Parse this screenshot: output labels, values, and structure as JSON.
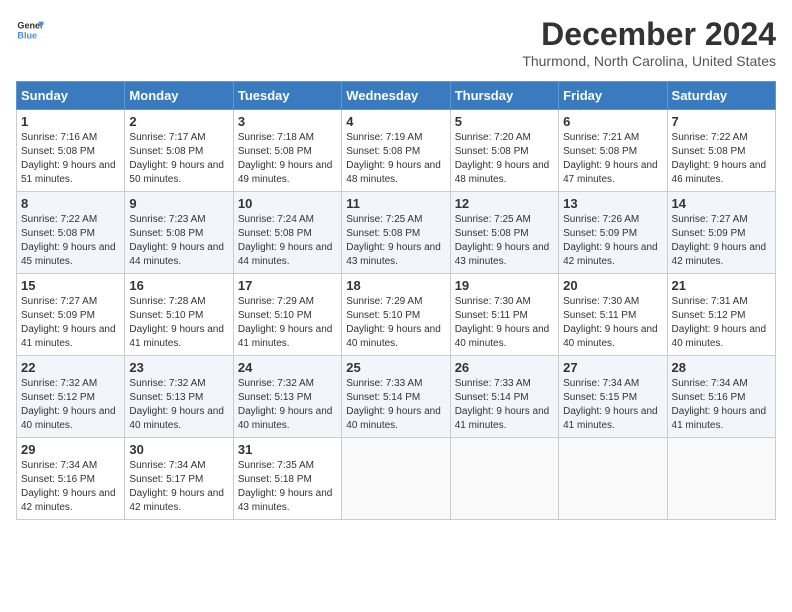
{
  "header": {
    "logo_line1": "General",
    "logo_line2": "Blue",
    "month": "December 2024",
    "location": "Thurmond, North Carolina, United States"
  },
  "days_of_week": [
    "Sunday",
    "Monday",
    "Tuesday",
    "Wednesday",
    "Thursday",
    "Friday",
    "Saturday"
  ],
  "weeks": [
    [
      {
        "day": "1",
        "sunrise": "7:16 AM",
        "sunset": "5:08 PM",
        "daylight": "9 hours and 51 minutes."
      },
      {
        "day": "2",
        "sunrise": "7:17 AM",
        "sunset": "5:08 PM",
        "daylight": "9 hours and 50 minutes."
      },
      {
        "day": "3",
        "sunrise": "7:18 AM",
        "sunset": "5:08 PM",
        "daylight": "9 hours and 49 minutes."
      },
      {
        "day": "4",
        "sunrise": "7:19 AM",
        "sunset": "5:08 PM",
        "daylight": "9 hours and 48 minutes."
      },
      {
        "day": "5",
        "sunrise": "7:20 AM",
        "sunset": "5:08 PM",
        "daylight": "9 hours and 48 minutes."
      },
      {
        "day": "6",
        "sunrise": "7:21 AM",
        "sunset": "5:08 PM",
        "daylight": "9 hours and 47 minutes."
      },
      {
        "day": "7",
        "sunrise": "7:22 AM",
        "sunset": "5:08 PM",
        "daylight": "9 hours and 46 minutes."
      }
    ],
    [
      {
        "day": "8",
        "sunrise": "7:22 AM",
        "sunset": "5:08 PM",
        "daylight": "9 hours and 45 minutes."
      },
      {
        "day": "9",
        "sunrise": "7:23 AM",
        "sunset": "5:08 PM",
        "daylight": "9 hours and 44 minutes."
      },
      {
        "day": "10",
        "sunrise": "7:24 AM",
        "sunset": "5:08 PM",
        "daylight": "9 hours and 44 minutes."
      },
      {
        "day": "11",
        "sunrise": "7:25 AM",
        "sunset": "5:08 PM",
        "daylight": "9 hours and 43 minutes."
      },
      {
        "day": "12",
        "sunrise": "7:25 AM",
        "sunset": "5:08 PM",
        "daylight": "9 hours and 43 minutes."
      },
      {
        "day": "13",
        "sunrise": "7:26 AM",
        "sunset": "5:09 PM",
        "daylight": "9 hours and 42 minutes."
      },
      {
        "day": "14",
        "sunrise": "7:27 AM",
        "sunset": "5:09 PM",
        "daylight": "9 hours and 42 minutes."
      }
    ],
    [
      {
        "day": "15",
        "sunrise": "7:27 AM",
        "sunset": "5:09 PM",
        "daylight": "9 hours and 41 minutes."
      },
      {
        "day": "16",
        "sunrise": "7:28 AM",
        "sunset": "5:10 PM",
        "daylight": "9 hours and 41 minutes."
      },
      {
        "day": "17",
        "sunrise": "7:29 AM",
        "sunset": "5:10 PM",
        "daylight": "9 hours and 41 minutes."
      },
      {
        "day": "18",
        "sunrise": "7:29 AM",
        "sunset": "5:10 PM",
        "daylight": "9 hours and 40 minutes."
      },
      {
        "day": "19",
        "sunrise": "7:30 AM",
        "sunset": "5:11 PM",
        "daylight": "9 hours and 40 minutes."
      },
      {
        "day": "20",
        "sunrise": "7:30 AM",
        "sunset": "5:11 PM",
        "daylight": "9 hours and 40 minutes."
      },
      {
        "day": "21",
        "sunrise": "7:31 AM",
        "sunset": "5:12 PM",
        "daylight": "9 hours and 40 minutes."
      }
    ],
    [
      {
        "day": "22",
        "sunrise": "7:32 AM",
        "sunset": "5:12 PM",
        "daylight": "9 hours and 40 minutes."
      },
      {
        "day": "23",
        "sunrise": "7:32 AM",
        "sunset": "5:13 PM",
        "daylight": "9 hours and 40 minutes."
      },
      {
        "day": "24",
        "sunrise": "7:32 AM",
        "sunset": "5:13 PM",
        "daylight": "9 hours and 40 minutes."
      },
      {
        "day": "25",
        "sunrise": "7:33 AM",
        "sunset": "5:14 PM",
        "daylight": "9 hours and 40 minutes."
      },
      {
        "day": "26",
        "sunrise": "7:33 AM",
        "sunset": "5:14 PM",
        "daylight": "9 hours and 41 minutes."
      },
      {
        "day": "27",
        "sunrise": "7:34 AM",
        "sunset": "5:15 PM",
        "daylight": "9 hours and 41 minutes."
      },
      {
        "day": "28",
        "sunrise": "7:34 AM",
        "sunset": "5:16 PM",
        "daylight": "9 hours and 41 minutes."
      }
    ],
    [
      {
        "day": "29",
        "sunrise": "7:34 AM",
        "sunset": "5:16 PM",
        "daylight": "9 hours and 42 minutes."
      },
      {
        "day": "30",
        "sunrise": "7:34 AM",
        "sunset": "5:17 PM",
        "daylight": "9 hours and 42 minutes."
      },
      {
        "day": "31",
        "sunrise": "7:35 AM",
        "sunset": "5:18 PM",
        "daylight": "9 hours and 43 minutes."
      },
      null,
      null,
      null,
      null
    ]
  ]
}
